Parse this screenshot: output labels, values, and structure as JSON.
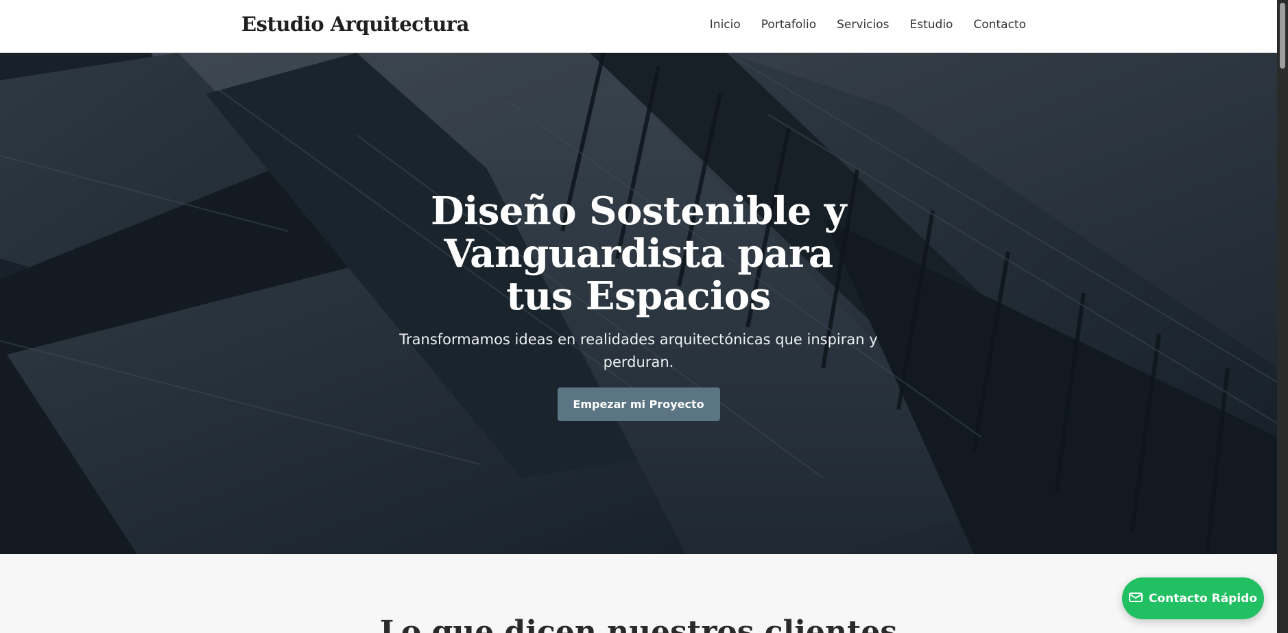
{
  "navbar": {
    "brand": "Estudio Arquitectura",
    "links": [
      "Inicio",
      "Portafolio",
      "Servicios",
      "Estudio",
      "Contacto"
    ]
  },
  "hero": {
    "title": "Diseño Sostenible y Vanguardista para tus Espacios",
    "subtitle": "Transformamos ideas en realidades arquitectónicas que inspiran y perduran.",
    "cta_label": "Empezar mi Proyecto"
  },
  "testimonials": {
    "title": "Lo que dicen nuestros clientes"
  },
  "quick_contact": {
    "label": "Contacto Rápido",
    "icon": "envelope-icon"
  },
  "colors": {
    "cta_button": "#5c7585",
    "quick_contact": "#21c063",
    "navbar_bg": "#ffffff",
    "section_bg": "#f7f7f7"
  }
}
